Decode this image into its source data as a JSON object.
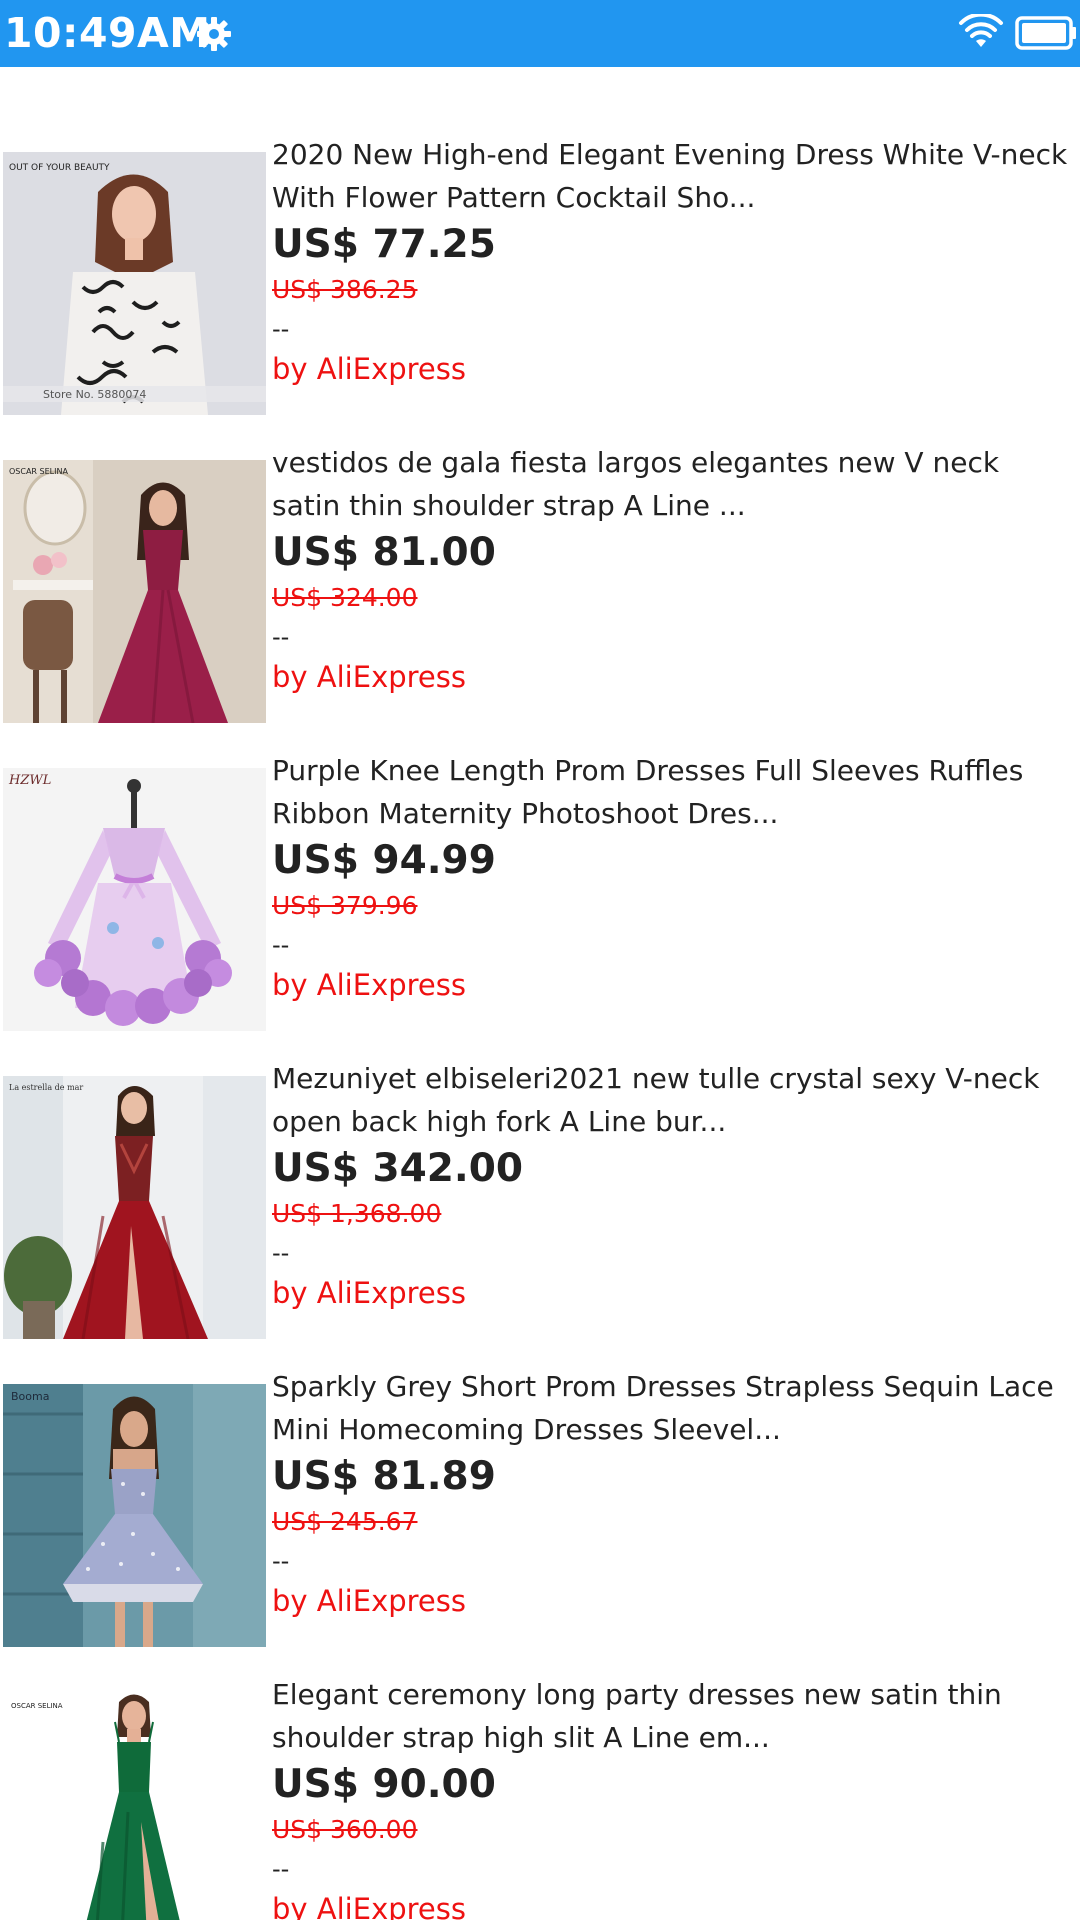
{
  "status_bar": {
    "time": "10:49AM",
    "icons": [
      "gear-icon",
      "wifi-icon",
      "battery-icon"
    ],
    "background": "#2196f0"
  },
  "colors": {
    "price": "#222222",
    "original_price": "#ee1111",
    "seller": "#ee1111"
  },
  "products": [
    {
      "title": "2020 New High-end Elegant Evening Dress White V-neck With Flower Pattern Cocktail Sho...",
      "price": "US$ 77.25",
      "original_price": "US$ 386.25",
      "rating": "--",
      "seller": "by AliExpress",
      "image_brand": "OUT OF YOUR BEAUTY",
      "image_footer": "Store No. 5880074"
    },
    {
      "title": "vestidos de gala fiesta largos elegantes new V neck satin thin shoulder strap A Line ...",
      "price": "US$ 81.00",
      "original_price": "US$ 324.00",
      "rating": "--",
      "seller": "by AliExpress",
      "image_brand": "OSCAR SELINA"
    },
    {
      "title": "Purple Knee Length Prom Dresses Full Sleeves Ruffles Ribbon Maternity Photoshoot Dres...",
      "price": "US$ 94.99",
      "original_price": "US$ 379.96",
      "rating": "--",
      "seller": "by AliExpress",
      "image_brand": "HZWL"
    },
    {
      "title": "Mezuniyet elbiseleri2021 new tulle crystal sexy V-neck open back high fork A Line bur...",
      "price": "US$ 342.00",
      "original_price": "US$ 1,368.00",
      "rating": "--",
      "seller": "by AliExpress",
      "image_brand": "La estrella de mar"
    },
    {
      "title": "Sparkly Grey Short Prom Dresses Strapless Sequin Lace Mini Homecoming Dresses Sleevel...",
      "price": "US$ 81.89",
      "original_price": "US$ 245.67",
      "rating": "--",
      "seller": "by AliExpress",
      "image_brand": "Booma"
    },
    {
      "title": "Elegant ceremony long party dresses new satin thin shoulder strap high slit A Line em...",
      "price": "US$ 90.00",
      "original_price": "US$ 360.00",
      "rating": "--",
      "seller": "by AliExpress",
      "image_brand": "OSCAR SELINA"
    }
  ]
}
